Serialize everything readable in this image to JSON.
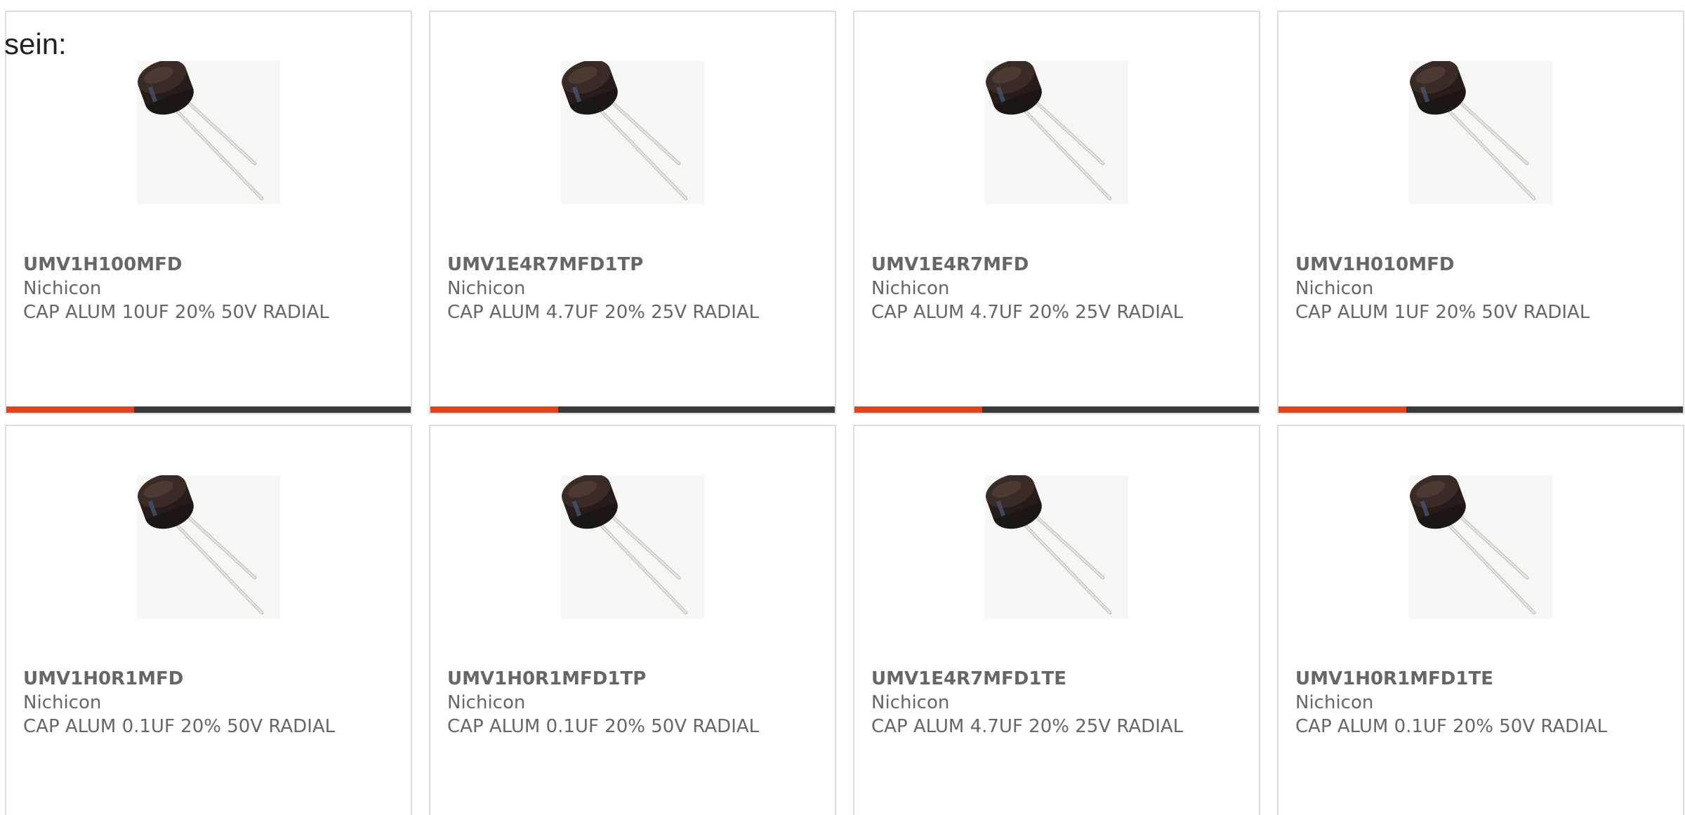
{
  "lead_text": "sein:",
  "colors": {
    "accent_bar": "#e8411a",
    "base_bar": "#3a3a3a",
    "card_border": "#dddddd",
    "text": "#666666"
  },
  "products": [
    {
      "part_number": "UMV1H100MFD",
      "manufacturer": "Nichicon",
      "description": "CAP ALUM 10UF 20% 50V RADIAL",
      "image_icon": "radial-capacitor-image"
    },
    {
      "part_number": "UMV1E4R7MFD1TP",
      "manufacturer": "Nichicon",
      "description": "CAP ALUM 4.7UF 20% 25V RADIAL",
      "image_icon": "radial-capacitor-image"
    },
    {
      "part_number": "UMV1E4R7MFD",
      "manufacturer": "Nichicon",
      "description": "CAP ALUM 4.7UF 20% 25V RADIAL",
      "image_icon": "radial-capacitor-image"
    },
    {
      "part_number": "UMV1H010MFD",
      "manufacturer": "Nichicon",
      "description": "CAP ALUM 1UF 20% 50V RADIAL",
      "image_icon": "radial-capacitor-image"
    },
    {
      "part_number": "UMV1H0R1MFD",
      "manufacturer": "Nichicon",
      "description": "CAP ALUM 0.1UF 20% 50V RADIAL",
      "image_icon": "radial-capacitor-image"
    },
    {
      "part_number": "UMV1H0R1MFD1TP",
      "manufacturer": "Nichicon",
      "description": "CAP ALUM 0.1UF 20% 50V RADIAL",
      "image_icon": "radial-capacitor-image"
    },
    {
      "part_number": "UMV1E4R7MFD1TE",
      "manufacturer": "Nichicon",
      "description": "CAP ALUM 4.7UF 20% 25V RADIAL",
      "image_icon": "radial-capacitor-image"
    },
    {
      "part_number": "UMV1H0R1MFD1TE",
      "manufacturer": "Nichicon",
      "description": "CAP ALUM 0.1UF 20% 50V RADIAL",
      "image_icon": "radial-capacitor-image"
    }
  ]
}
